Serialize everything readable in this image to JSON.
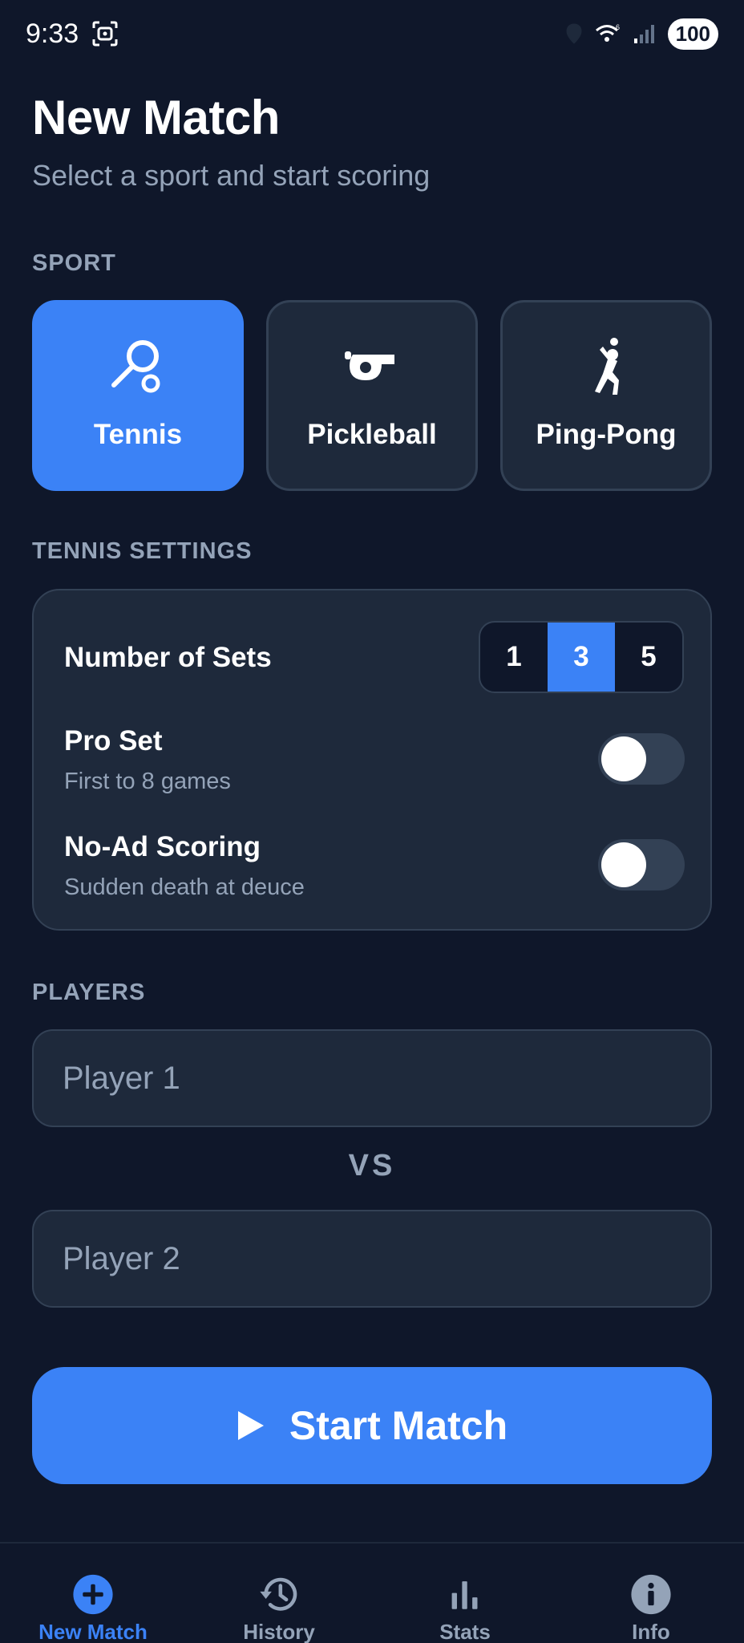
{
  "status_bar": {
    "time": "9:33",
    "battery": "100",
    "icons": [
      "screenshot-icon",
      "location-icon",
      "wifi-icon",
      "signal-icon"
    ]
  },
  "header": {
    "title": "New Match",
    "subtitle": "Select a sport and start scoring"
  },
  "sport_section": {
    "label": "SPORT",
    "sports": [
      {
        "label": "Tennis",
        "icon": "tennis-racket-icon",
        "selected": true
      },
      {
        "label": "Pickleball",
        "icon": "whistle-icon",
        "selected": false
      },
      {
        "label": "Ping-Pong",
        "icon": "player-serving-icon",
        "selected": false
      }
    ]
  },
  "settings_section": {
    "label": "TENNIS SETTINGS",
    "number_of_sets": {
      "title": "Number of Sets",
      "options": [
        "1",
        "3",
        "5"
      ],
      "selected": "3"
    },
    "pro_set": {
      "title": "Pro Set",
      "description": "First to 8 games",
      "enabled": false
    },
    "no_ad_scoring": {
      "title": "No-Ad Scoring",
      "description": "Sudden death at deuce",
      "enabled": false
    }
  },
  "players_section": {
    "label": "PLAYERS",
    "player1_placeholder": "Player 1",
    "vs": "VS",
    "player2_placeholder": "Player 2"
  },
  "start_button": {
    "label": "Start Match",
    "icon": "play-icon"
  },
  "bottom_nav": {
    "items": [
      {
        "label": "New Match",
        "icon": "plus-circle-icon",
        "active": true
      },
      {
        "label": "History",
        "icon": "history-icon",
        "active": false
      },
      {
        "label": "Stats",
        "icon": "bar-chart-icon",
        "active": false
      },
      {
        "label": "Info",
        "icon": "info-icon",
        "active": false
      }
    ]
  },
  "colors": {
    "background": "#0f172a",
    "surface": "#1e293b",
    "border": "#334155",
    "accent": "#3b82f6",
    "muted_text": "#94a3b8"
  }
}
